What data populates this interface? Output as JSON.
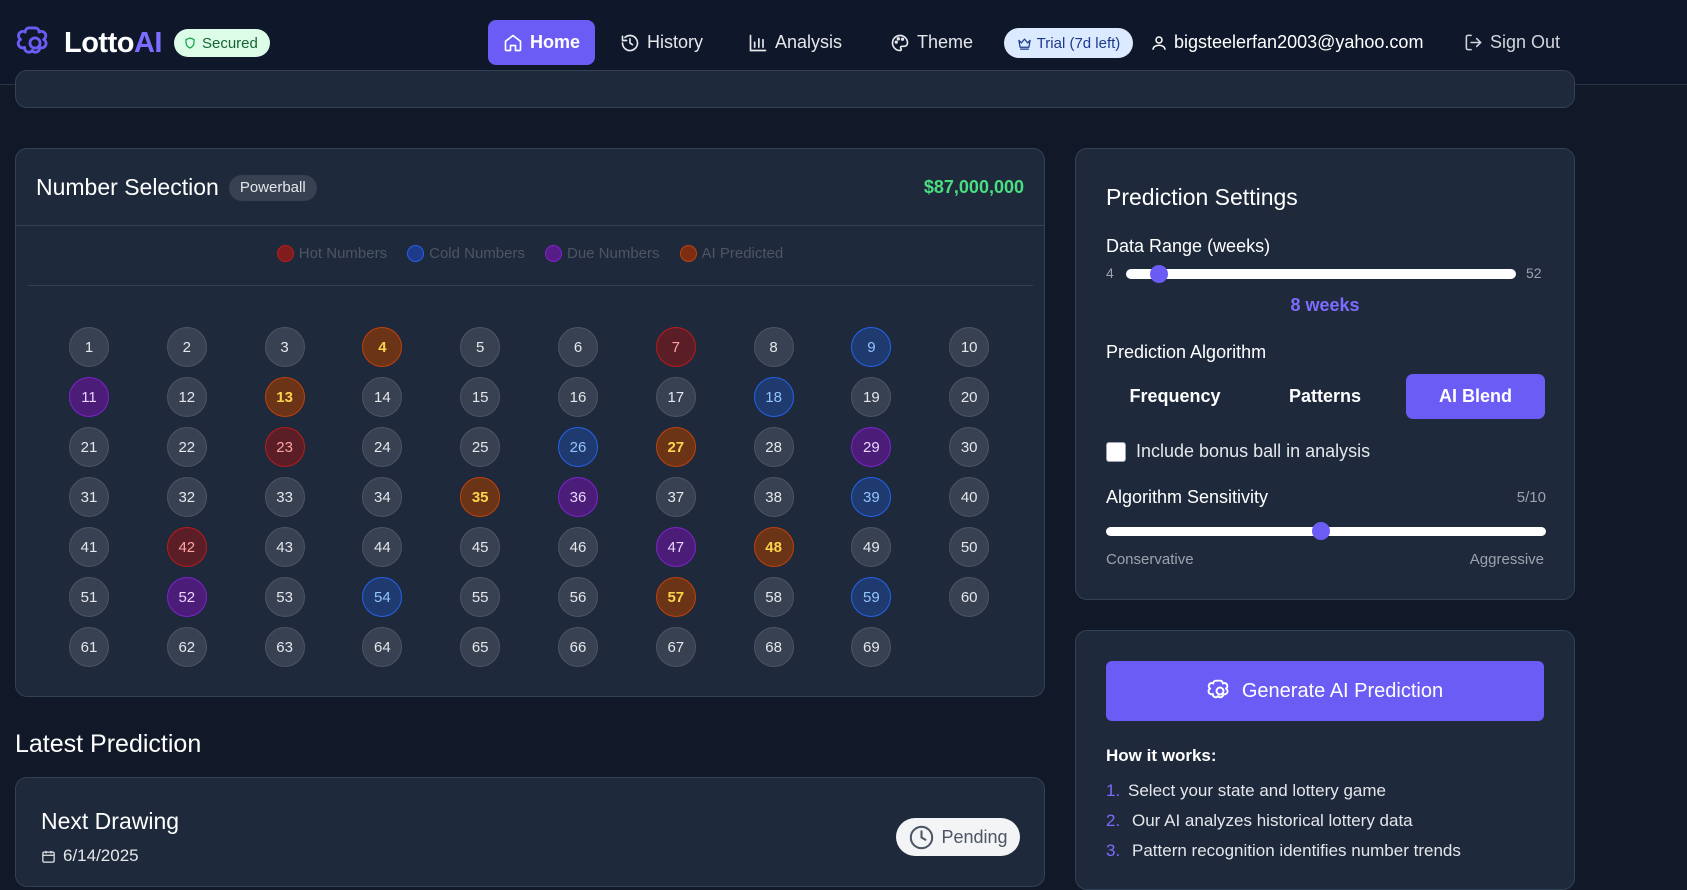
{
  "header": {
    "brand_part1": "Lotto",
    "brand_part2": "AI",
    "secured_label": "Secured",
    "nav": {
      "home": "Home",
      "history": "History",
      "analysis": "Analysis",
      "theme": "Theme"
    },
    "trial_label": "Trial (7d left)",
    "user_email": "bigsteelerfan2003@yahoo.com",
    "sign_out": "Sign Out"
  },
  "number_selection": {
    "title": "Number Selection",
    "game": "Powerball",
    "jackpot": "$87,000,000",
    "legend": [
      {
        "label": "Hot Numbers",
        "color": "#7f1d1d"
      },
      {
        "label": "Cold Numbers",
        "color": "#1e3a8a"
      },
      {
        "label": "Due Numbers",
        "color": "#581c87"
      },
      {
        "label": "AI Predicted",
        "color": "#7c2d12"
      }
    ],
    "hot": [
      7,
      23,
      42
    ],
    "cold": [
      9,
      18,
      26,
      39,
      54,
      59
    ],
    "due": [
      11,
      29,
      36,
      47,
      52
    ],
    "ai_predicted": [
      4,
      13,
      27,
      35,
      48,
      57
    ],
    "max_number": 69
  },
  "latest_prediction": {
    "section_title": "Latest Prediction",
    "card_title": "Next Drawing",
    "date": "6/14/2025",
    "status": "Pending"
  },
  "settings": {
    "title": "Prediction Settings",
    "data_range_label": "Data Range (weeks)",
    "range_min": "4",
    "range_max": "52",
    "range_value_num": 8,
    "range_value_label": "8 weeks",
    "algorithm_label": "Prediction Algorithm",
    "algorithms": [
      "Frequency",
      "Patterns",
      "AI Blend"
    ],
    "selected_algorithm": "AI Blend",
    "bonus_label": "Include bonus ball in analysis",
    "bonus_checked": false,
    "sensitivity_label": "Algorithm Sensitivity",
    "sensitivity_value": "5/10",
    "sensitivity_num": 5,
    "sensitivity_max": 10,
    "conservative": "Conservative",
    "aggressive": "Aggressive"
  },
  "generate": {
    "button": "Generate AI Prediction",
    "how_title": "How it works:",
    "steps": [
      {
        "num": "1.",
        "text": "Select your state and lottery game"
      },
      {
        "num": "2.",
        "text": "Our AI analyzes historical lottery data"
      },
      {
        "num": "3.",
        "text": "Pattern recognition identifies number trends"
      }
    ]
  },
  "colors": {
    "accent": "#6b5cf6",
    "jackpot": "#4ade80",
    "background": "#111827",
    "card": "#1e293b"
  }
}
